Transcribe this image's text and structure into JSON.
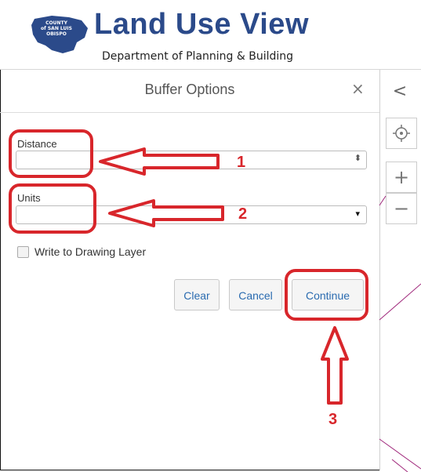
{
  "header": {
    "logo_lines": [
      "COUNTY",
      "of SAN LUIS",
      "OBISPO"
    ],
    "title": "Land Use View",
    "subtitle": "Department of Planning & Building"
  },
  "panel": {
    "title": "Buffer Options",
    "close_label": "×",
    "distance": {
      "label": "Distance",
      "value": "",
      "spinner": "⬍"
    },
    "units": {
      "label": "Units",
      "value": "",
      "arrow": "▾"
    },
    "drawing_layer": {
      "label": "Write to Drawing Layer",
      "checked": false
    },
    "buttons": {
      "clear": "Clear",
      "cancel": "Cancel",
      "continue": "Continue"
    }
  },
  "map_controls": {
    "collapse": "<",
    "locate": "⌖",
    "zoom_in": "+",
    "zoom_out": "−"
  },
  "annotations": {
    "num1": "1",
    "num2": "2",
    "num3": "3"
  },
  "colors": {
    "brand_blue": "#2b4a8a",
    "annotation_red": "#d8262b",
    "link_blue": "#2a6bb0"
  }
}
